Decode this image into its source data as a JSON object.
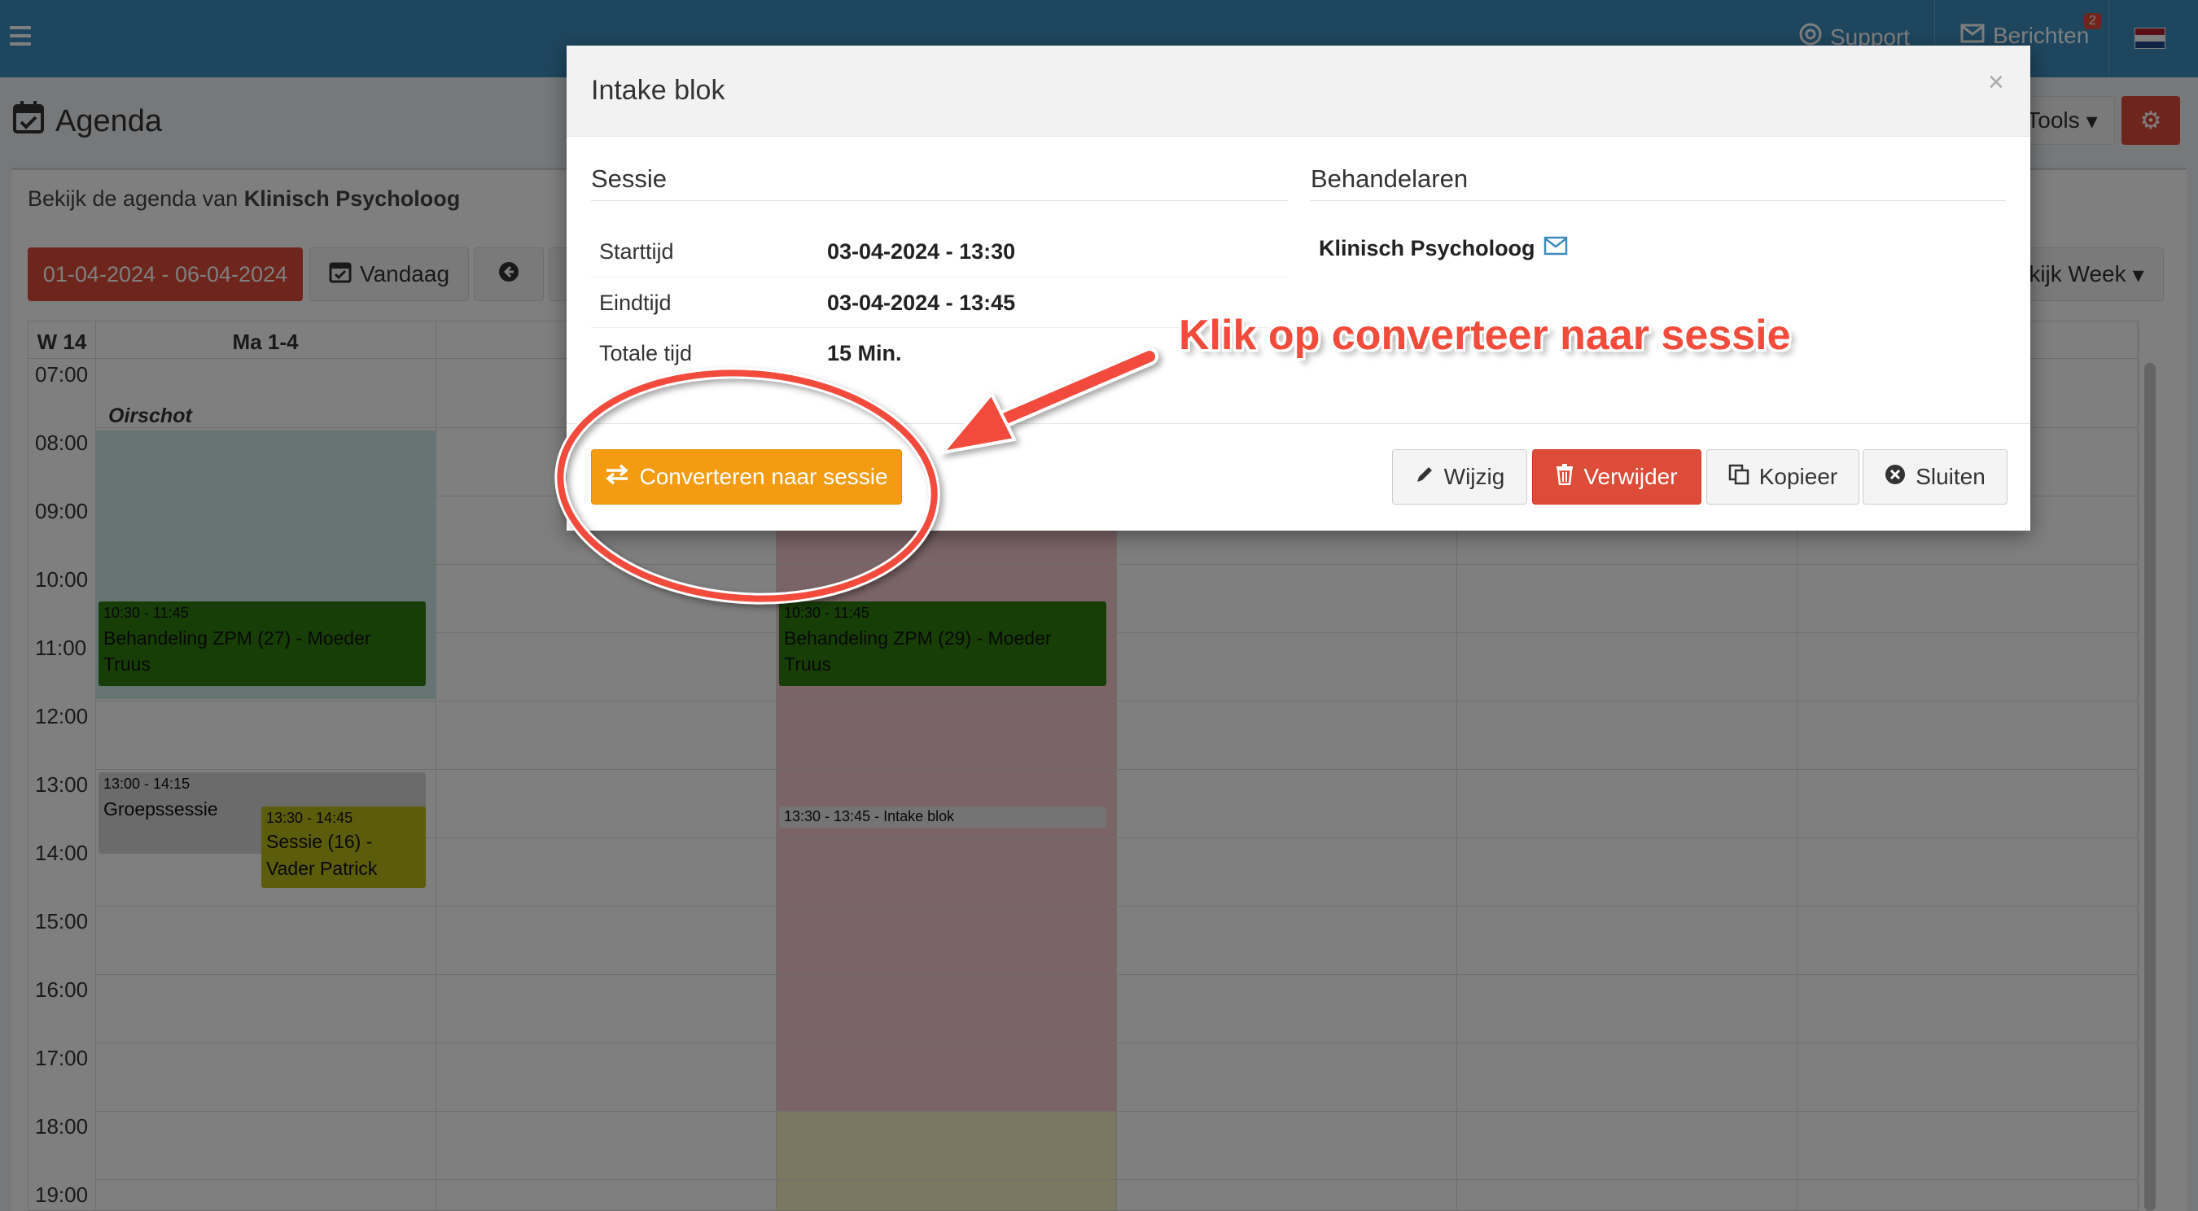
{
  "topbar": {
    "support_label": "Support",
    "messages_label": "Berichten",
    "messages_badge": "2"
  },
  "page": {
    "title": "Agenda",
    "tools_label": "Tools"
  },
  "agenda": {
    "header_prefix": "Bekijk de agenda van",
    "header_name": "Klinisch Psycholoog",
    "date_range": "01-04-2024 - 06-04-2024",
    "today_label": "Vandaag",
    "view_label": "kijk Week",
    "week_label": "W 14",
    "day_label": "Ma 1-4",
    "location_label": "Oirschot",
    "hours": [
      "07:00",
      "08:00",
      "09:00",
      "10:00",
      "11:00",
      "12:00",
      "13:00",
      "14:00",
      "15:00",
      "16:00",
      "17:00",
      "18:00",
      "19:00"
    ],
    "events": {
      "e1": {
        "time": "10:30 - 11:45",
        "title": "Behandeling ZPM (27) - Moeder Truus",
        "color": "#2e7d0f"
      },
      "e2": {
        "time": "10:30 - 11:45",
        "title": "Behandeling ZPM (29) - Moeder Truus",
        "color": "#2e7d0f"
      },
      "e3": {
        "time": "13:00 - 14:15",
        "title": "Groepssessie",
        "color": "#d6d6d6"
      },
      "e4": {
        "time": "13:30 - 14:45",
        "title": "Sessie (16) - Vader Patrick",
        "color": "#b8b81a"
      },
      "e5": {
        "time": "13:30 - 13:45 - Intake blok",
        "color": "#e8e8e8"
      }
    }
  },
  "modal": {
    "title": "Intake blok",
    "close_symbol": "×",
    "session_section": "Sessie",
    "therapists_section": "Behandelaren",
    "rows": [
      {
        "label": "Starttijd",
        "value": "03-04-2024 - 13:30"
      },
      {
        "label": "Eindtijd",
        "value": "03-04-2024 - 13:45"
      },
      {
        "label": "Totale tijd",
        "value": "15 Min."
      }
    ],
    "therapist": "Klinisch Psycholoog",
    "buttons": {
      "convert": "Converteren naar sessie",
      "edit": "Wijzig",
      "delete": "Verwijder",
      "copy": "Kopieer",
      "close": "Sluiten"
    }
  },
  "annotation": {
    "text": "Klik op converteer naar sessie",
    "color": "#f24b3c"
  }
}
